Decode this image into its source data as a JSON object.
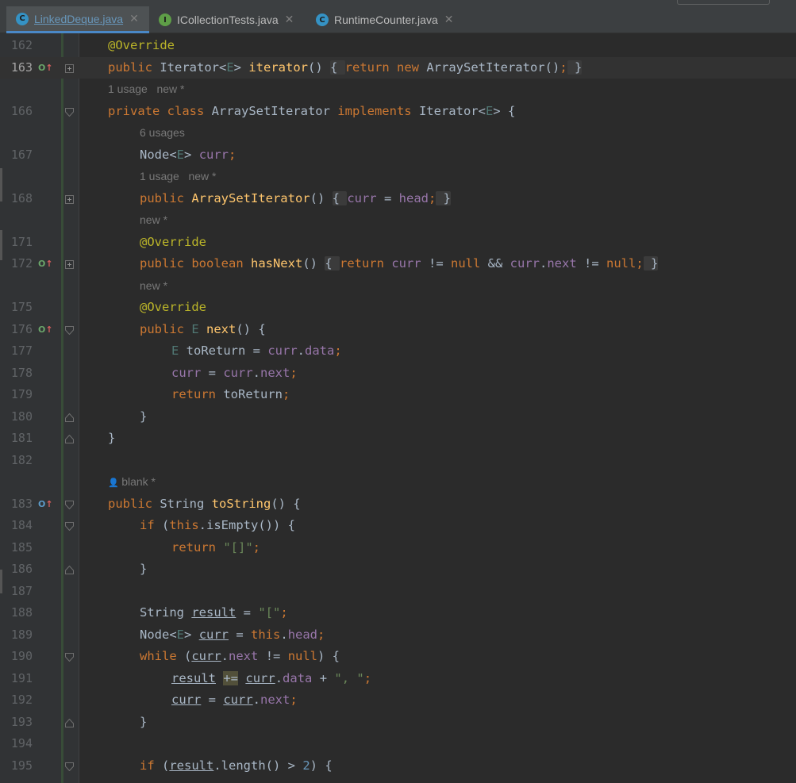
{
  "tabs": [
    {
      "label": "LinkedDeque.java",
      "icon": "C",
      "active": true
    },
    {
      "label": "ICollectionTests.java",
      "icon": "I",
      "active": false
    },
    {
      "label": "RuntimeCounter.java",
      "icon": "C",
      "active": false
    }
  ],
  "colors": {
    "keyword": "#cc7832",
    "method": "#ffc66d",
    "annotation": "#bbb529",
    "field": "#9876aa",
    "string": "#6a8759",
    "type_param": "#507874",
    "text": "#a9b7c6",
    "line_number": "#606366",
    "hint": "#787878"
  },
  "hints": {
    "h1": "1 usage   new *",
    "h2": "6 usages",
    "h3": "1 usage   new *",
    "h4": "new *",
    "h5": "new *",
    "h6": "blank *"
  },
  "lines": {
    "l162": {
      "num": "162",
      "text": "@Override"
    },
    "l163": {
      "num": "163",
      "text": "public Iterator<E> iterator() { return new ArraySetIterator(); }"
    },
    "l166": {
      "num": "166",
      "text": "private class ArraySetIterator implements Iterator<E> {"
    },
    "l167": {
      "num": "167",
      "text": "Node<E> curr;"
    },
    "l168": {
      "num": "168",
      "text": "public ArraySetIterator() { curr = head; }"
    },
    "l171": {
      "num": "171",
      "text": "@Override"
    },
    "l172": {
      "num": "172",
      "text": "public boolean hasNext() { return curr != null && curr.next != null; }"
    },
    "l175": {
      "num": "175",
      "text": "@Override"
    },
    "l176": {
      "num": "176",
      "text": "public E next() {"
    },
    "l177": {
      "num": "177",
      "text": "E toReturn = curr.data;"
    },
    "l178": {
      "num": "178",
      "text": "curr = curr.next;"
    },
    "l179": {
      "num": "179",
      "text": "return toReturn;"
    },
    "l180": {
      "num": "180",
      "text": "}"
    },
    "l181": {
      "num": "181",
      "text": "}"
    },
    "l182": {
      "num": "182",
      "text": ""
    },
    "l183": {
      "num": "183",
      "text": "public String toString() {"
    },
    "l184": {
      "num": "184",
      "text": "if (this.isEmpty()) {"
    },
    "l185": {
      "num": "185",
      "text": "return \"[]\";"
    },
    "l186": {
      "num": "186",
      "text": "}"
    },
    "l187": {
      "num": "187",
      "text": ""
    },
    "l188": {
      "num": "188",
      "text": "String result = \"[\";"
    },
    "l189": {
      "num": "189",
      "text": "Node<E> curr = this.head;"
    },
    "l190": {
      "num": "190",
      "text": "while (curr.next != null) {"
    },
    "l191": {
      "num": "191",
      "text": "result += curr.data + \", \";"
    },
    "l192": {
      "num": "192",
      "text": "curr = curr.next;"
    },
    "l193": {
      "num": "193",
      "text": "}"
    },
    "l194": {
      "num": "194",
      "text": ""
    },
    "l195": {
      "num": "195",
      "text": "if (result.length() > 2) {"
    }
  }
}
